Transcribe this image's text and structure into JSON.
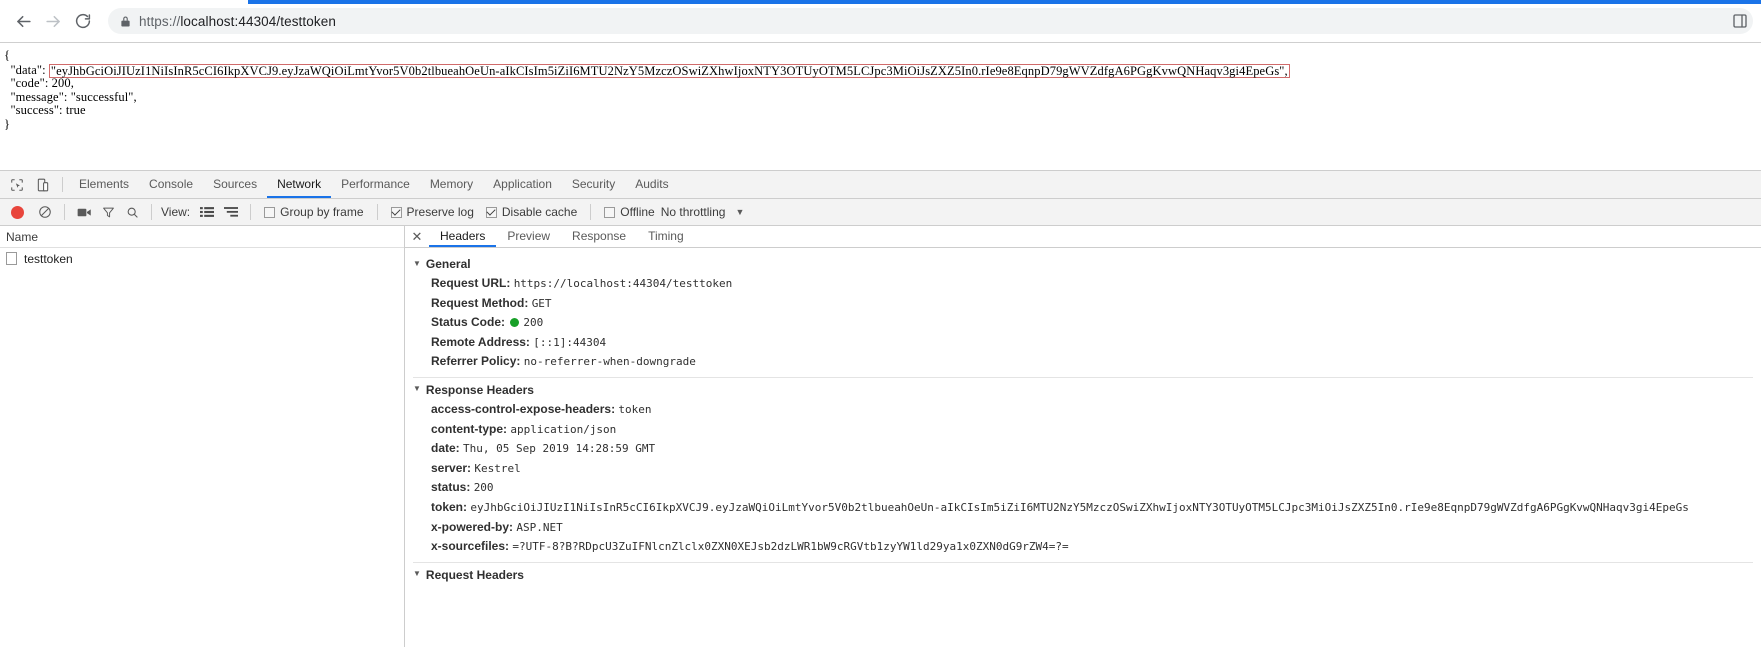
{
  "browser": {
    "back_label": "Back",
    "forward_label": "Forward",
    "reload_label": "Reload",
    "lock_label": "Secure connection",
    "url_scheme": "https://",
    "url_rest": "localhost:44304/testtoken",
    "url_full": "https://localhost:44304/testtoken",
    "menu_label": "Customize and control"
  },
  "response_body": {
    "open_brace": "{",
    "data_key": "\"data\":",
    "data_value": "\"eyJhbGciOiJIUzI1NiIsInR5cCI6IkpXVCJ9.eyJzaWQiOiLmtYvor5V0b2tlbueahOeUn-aIkCIsIm5iZiI6MTU2NzY5MzczOSwiZXhwIjoxNTY3OTUyOTM5LCJpc3MiOiJsZXZ5In0.rIe9e8EqnpD79gWVZdfgA6PGgKvwQNHaqv3gi4EpeGs\",",
    "code_line": "  \"code\": 200,",
    "message_line": "  \"message\": \"successful\",",
    "success_line": "  \"success\": true",
    "close_brace": "}"
  },
  "devtools": {
    "inspect_icon_label": "inspect-element",
    "device_icon_label": "toggle-device-toolbar",
    "tabs": [
      {
        "label": "Elements",
        "active": false
      },
      {
        "label": "Console",
        "active": false
      },
      {
        "label": "Sources",
        "active": false
      },
      {
        "label": "Network",
        "active": true
      },
      {
        "label": "Performance",
        "active": false
      },
      {
        "label": "Memory",
        "active": false
      },
      {
        "label": "Application",
        "active": false
      },
      {
        "label": "Security",
        "active": false
      },
      {
        "label": "Audits",
        "active": false
      }
    ],
    "toolbar": {
      "record_label": "Record network log",
      "clear_label": "Clear",
      "filmstrip_label": "Capture screenshots",
      "filter_label": "Filter",
      "search_label": "Search",
      "view_label": "View:",
      "view_list_label": "Use large request rows",
      "view_waterfall_label": "Show overview",
      "group_by_frame": "Group by frame",
      "group_by_frame_checked": false,
      "preserve_log": "Preserve log",
      "preserve_log_checked": true,
      "disable_cache": "Disable cache",
      "disable_cache_checked": true,
      "offline": "Offline",
      "offline_checked": false,
      "throttling": "No throttling",
      "throttling_caret": "▼"
    },
    "name_panel": {
      "header": "Name",
      "rows": [
        {
          "label": "testtoken"
        }
      ]
    },
    "detail_tabs": {
      "close": "✕",
      "tabs": [
        {
          "label": "Headers",
          "active": true
        },
        {
          "label": "Preview",
          "active": false
        },
        {
          "label": "Response",
          "active": false
        },
        {
          "label": "Timing",
          "active": false
        }
      ]
    },
    "sections": [
      {
        "title": "General",
        "triangle": "▼",
        "rows": [
          {
            "name": "Request URL:",
            "value": "https://localhost:44304/testtoken",
            "status_dot": false
          },
          {
            "name": "Request Method:",
            "value": "GET",
            "status_dot": false
          },
          {
            "name": "Status Code:",
            "value": "200",
            "status_dot": true
          },
          {
            "name": "Remote Address:",
            "value": "[::1]:44304",
            "status_dot": false
          },
          {
            "name": "Referrer Policy:",
            "value": "no-referrer-when-downgrade",
            "status_dot": false
          }
        ]
      },
      {
        "title": "Response Headers",
        "triangle": "▼",
        "rows": [
          {
            "name": "access-control-expose-headers:",
            "value": "token",
            "status_dot": false
          },
          {
            "name": "content-type:",
            "value": "application/json",
            "status_dot": false
          },
          {
            "name": "date:",
            "value": "Thu, 05 Sep 2019 14:28:59 GMT",
            "status_dot": false
          },
          {
            "name": "server:",
            "value": "Kestrel",
            "status_dot": false
          },
          {
            "name": "status:",
            "value": "200",
            "status_dot": false
          },
          {
            "name": "token:",
            "value": "eyJhbGciOiJIUzI1NiIsInR5cCI6IkpXVCJ9.eyJzaWQiOiLmtYvor5V0b2tlbueahOeUn-aIkCIsIm5iZiI6MTU2NzY5MzczOSwiZXhwIjoxNTY3OTUyOTM5LCJpc3MiOiJsZXZ5In0.rIe9e8EqnpD79gWVZdfgA6PGgKvwQNHaqv3gi4EpeGs",
            "status_dot": false
          },
          {
            "name": "x-powered-by:",
            "value": "ASP.NET",
            "status_dot": false
          },
          {
            "name": "x-sourcefiles:",
            "value": "=?UTF-8?B?RDpcU3ZuIFNlcnZlclx0ZXN0XEJsb2dzLWR1bW9cRGVtb1zyYW1ld29ya1x0ZXN0dG9rZW4=?=",
            "status_dot": false
          }
        ]
      },
      {
        "title": "Request Headers",
        "triangle": "▼",
        "rows": []
      }
    ]
  },
  "colors": {
    "accent": "#1a73e8",
    "record_red": "#e8453c",
    "status_green": "#18a028",
    "highlight_border": "#d06a6a"
  }
}
